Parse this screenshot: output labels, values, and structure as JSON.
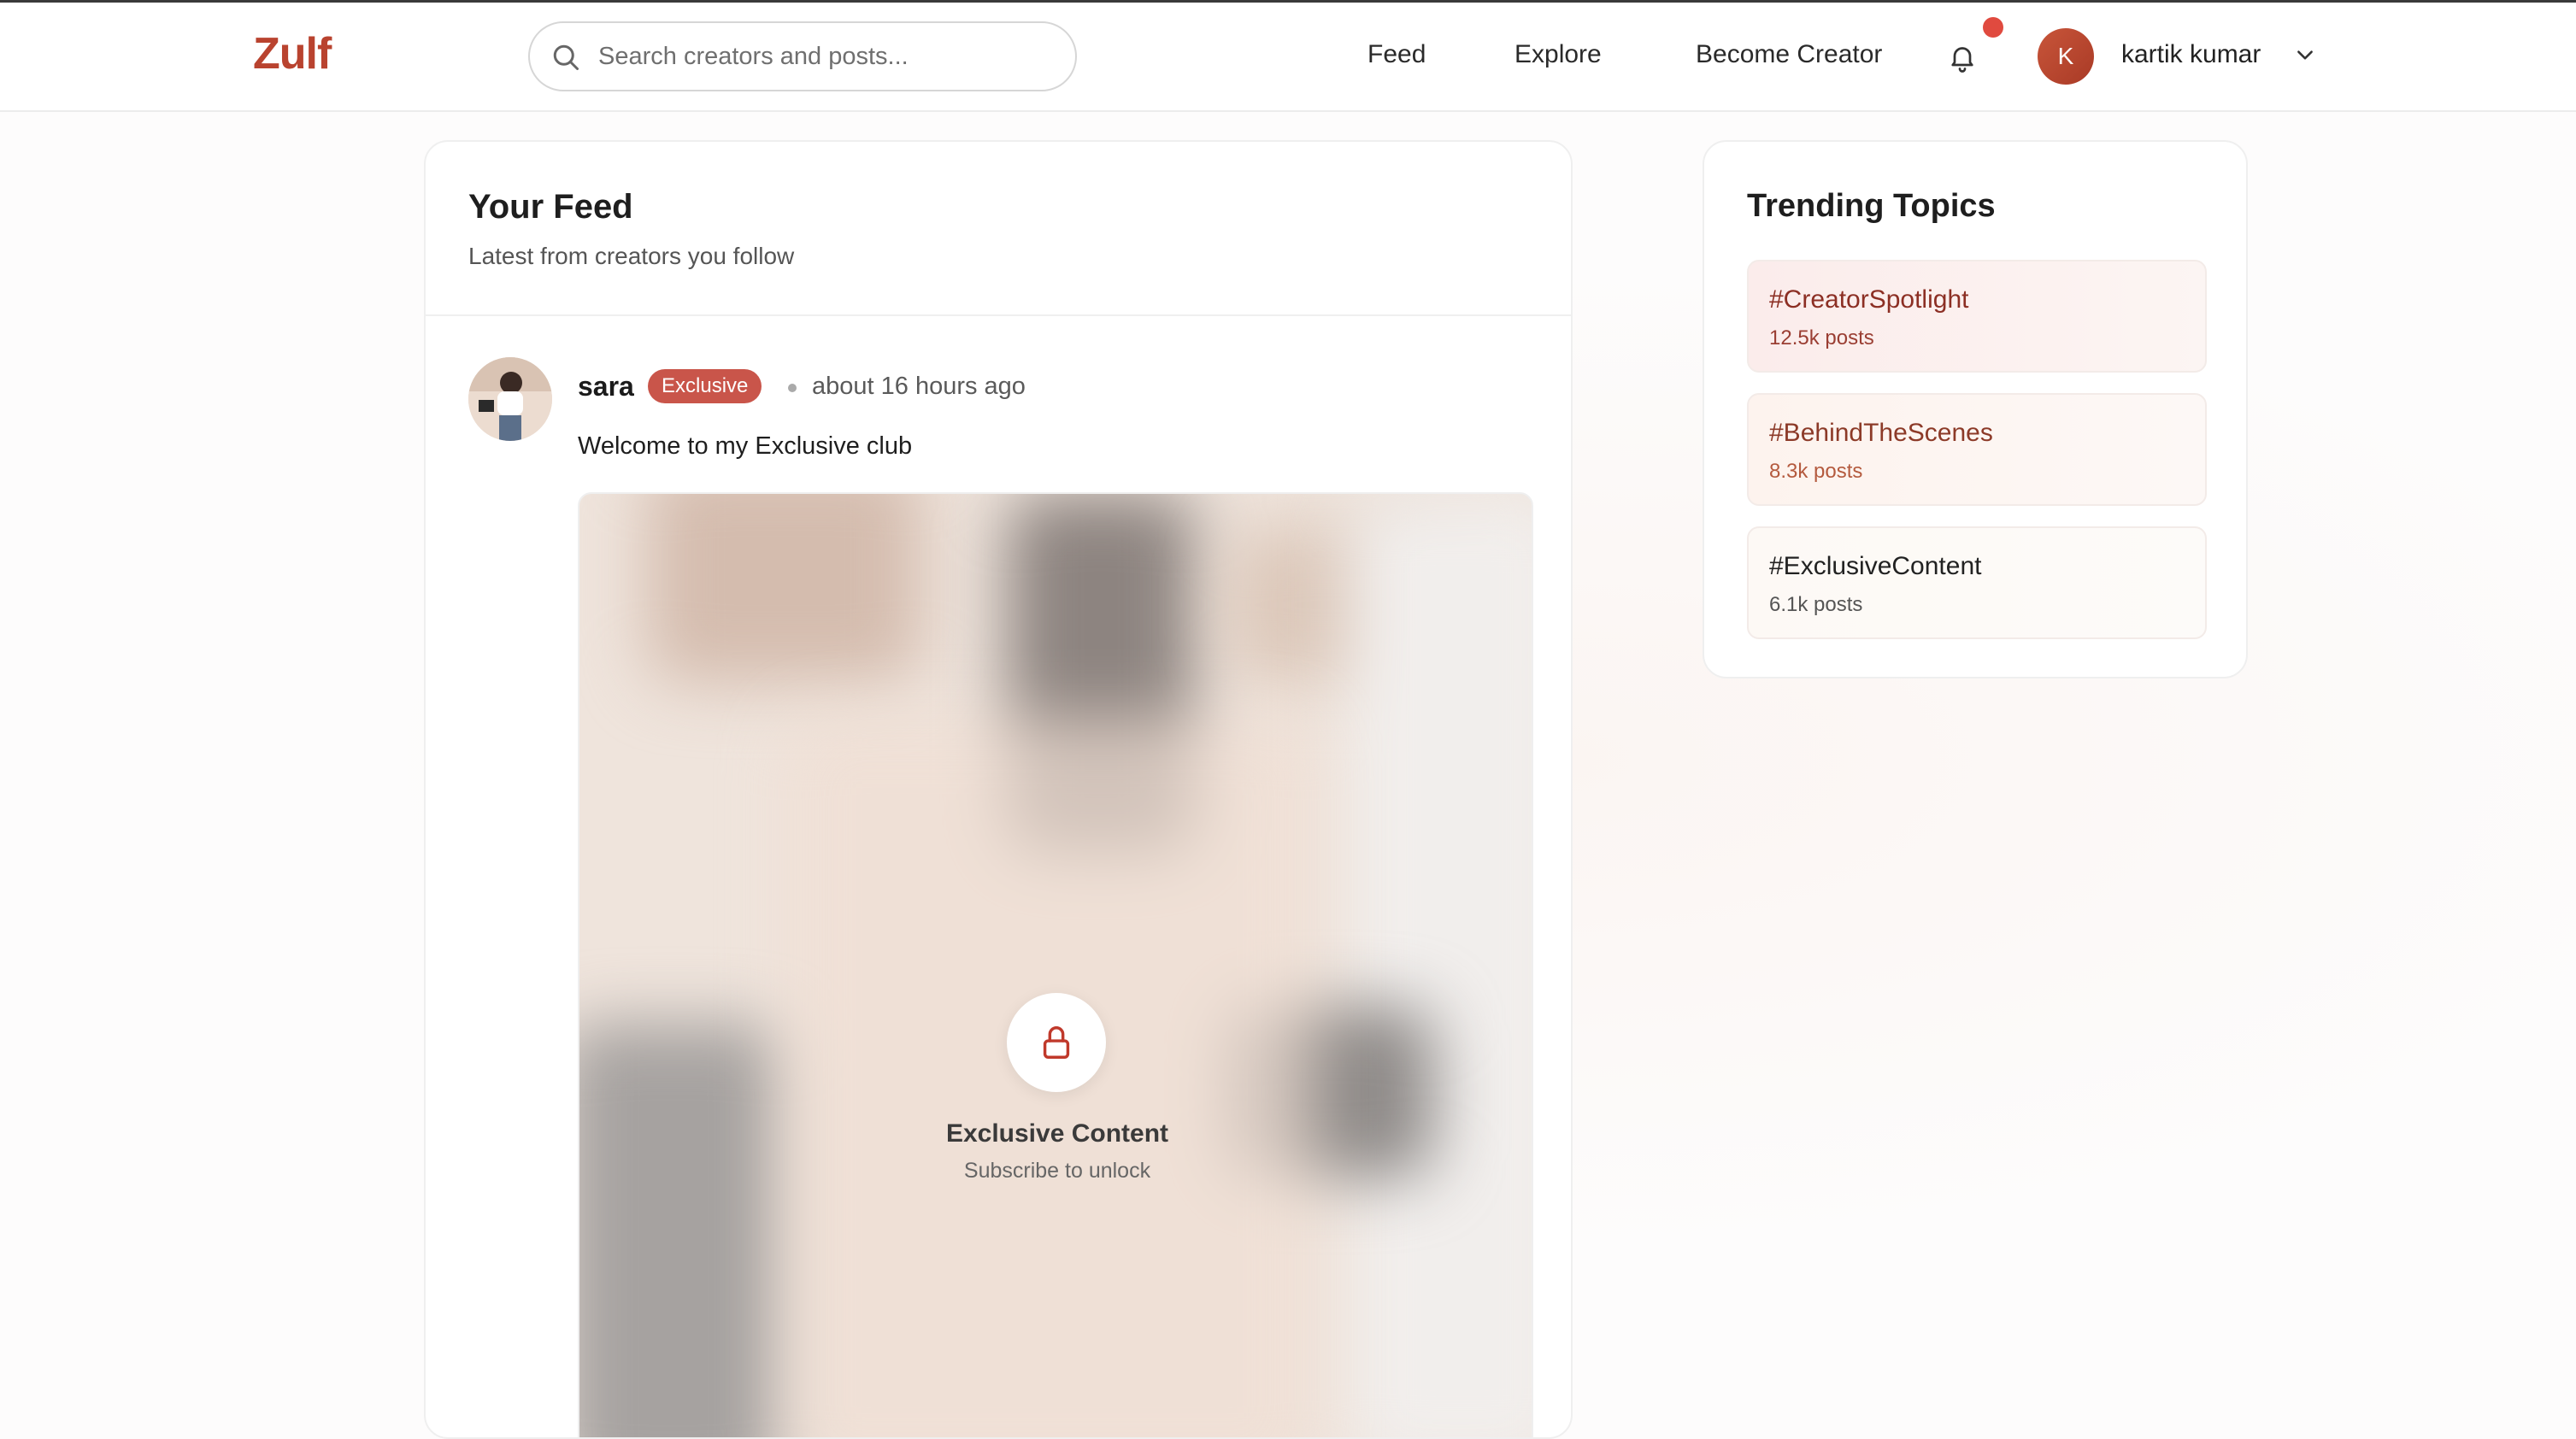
{
  "app": {
    "logo": "Zulf"
  },
  "search": {
    "placeholder": "Search creators and posts..."
  },
  "nav": {
    "links": [
      {
        "label": "Feed"
      },
      {
        "label": "Explore"
      },
      {
        "label": "Become Creator"
      }
    ],
    "user": {
      "initial": "K",
      "name": "kartik kumar"
    }
  },
  "feed": {
    "title": "Your Feed",
    "subtitle": "Latest from creators you follow",
    "post": {
      "author": "sara",
      "badge": "Exclusive",
      "time": "about 16 hours ago",
      "text": "Welcome to my Exclusive club",
      "locked_title": "Exclusive Content",
      "locked_subtitle": "Subscribe to unlock"
    }
  },
  "trending": {
    "title": "Trending Topics",
    "topics": [
      {
        "tag": "#CreatorSpotlight",
        "count": "12.5k posts"
      },
      {
        "tag": "#BehindTheScenes",
        "count": "8.3k posts"
      },
      {
        "tag": "#ExclusiveContent",
        "count": "6.1k posts"
      }
    ]
  },
  "colors": {
    "brand": "#b9432f",
    "badge": "#c9554a",
    "notification_dot": "#e04a3f"
  }
}
